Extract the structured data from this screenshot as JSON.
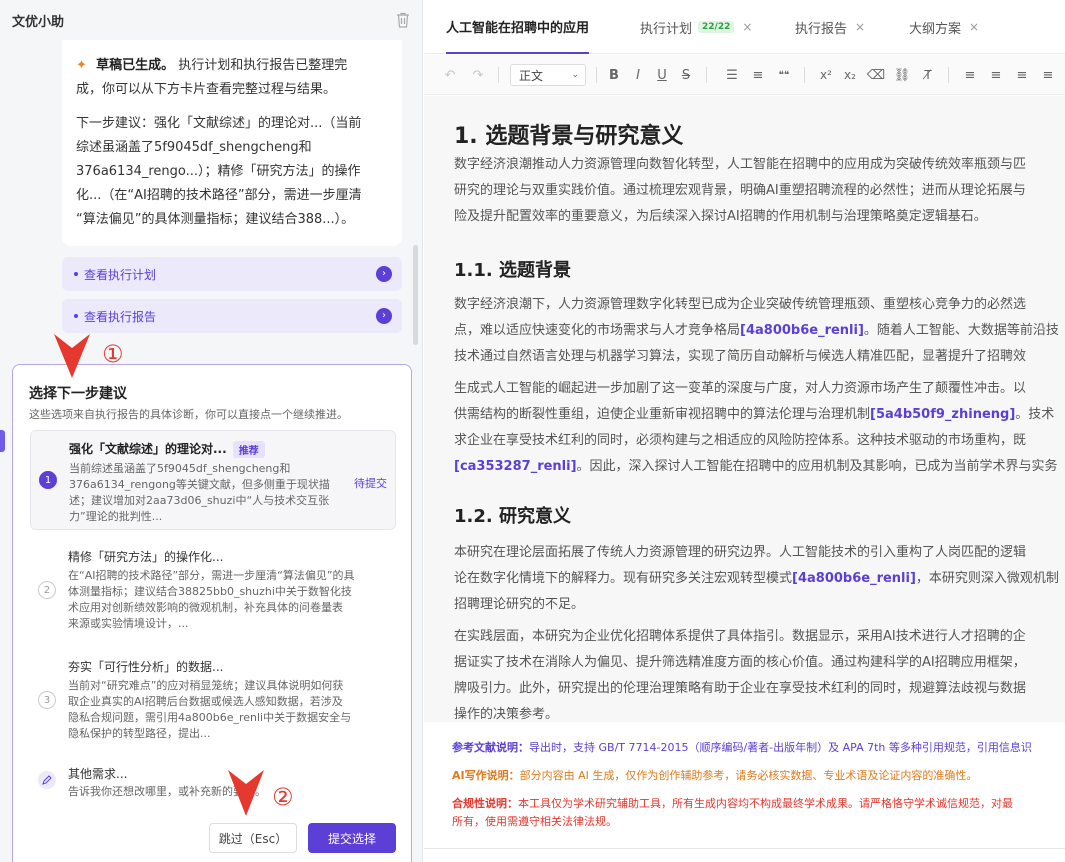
{
  "left": {
    "title": "文优小助",
    "message": {
      "headline": "草稿已生成。",
      "line1_rest": "执行计划和执行报告已整理完",
      "line2": "成，你可以从下方卡片查看完整过程与结果。",
      "p2_lines": [
        "下一步建议：强化「文献综述」的理论对...（当前",
        "综述虽涵盖了5f9045df_shengcheng和",
        "376a6134_rengo...）；精修「研究方法」的操作",
        "化...（在“AI招聘的技术路径”部分，需进一步厘清",
        "“算法偏见”的具体测量指标；建议结合388...）。"
      ]
    },
    "link_plan": "查看执行计划",
    "link_report": "查看执行报告",
    "suggestions": {
      "title": "选择下一步建议",
      "desc": "这些选项来自执行报告的具体诊断，你可以直接点一个继续推进。",
      "options": [
        {
          "num": "1",
          "title": "强化「文献综述」的理论对...",
          "badge": "推荐",
          "status": "待提交",
          "lines": [
            "当前综述虽涵盖了5f9045df_shengcheng和",
            "376a6134_rengong等关键文献，但多侧重于现状描",
            "述；建议增加对2aa73d06_shuzi中“人与技术交互张",
            "力”理论的批判性..."
          ]
        },
        {
          "num": "2",
          "title": "精修「研究方法」的操作化...",
          "lines": [
            "在“AI招聘的技术路径”部分，需进一步厘清“算法偏见”的具",
            "体测量指标；建议结合38825bb0_shuzhi中关于数智化技",
            "术应用对创新绩效影响的微观机制，补充具体的问卷量表",
            "来源或实验情境设计，..."
          ]
        },
        {
          "num": "3",
          "title": "夯实「可行性分析」的数据...",
          "lines": [
            "当前对“研究难点”的应对稍显笼统；建议具体说明如何获",
            "取企业真实的AI招聘后台数据或候选人感知数据，若涉及",
            "隐私合规问题，需引用4a800b6e_renli中关于数据安全与",
            "隐私保护的转型路径，提出..."
          ]
        },
        {
          "title": "其他需求...",
          "lines": [
            "告诉我你还想改哪里，或补充新的要求。"
          ]
        }
      ],
      "skip_label": "跳过（Esc）",
      "submit_label": "提交选择"
    },
    "annotations": [
      "①",
      "②"
    ]
  },
  "right": {
    "tabs": [
      {
        "label": "人工智能在招聘中的应用",
        "active": true
      },
      {
        "label": "执行计划",
        "count": "22/22",
        "close": "×"
      },
      {
        "label": "执行报告",
        "close": "×"
      },
      {
        "label": "大纲方案",
        "close": "×"
      }
    ],
    "toolbar": {
      "style_select": "正文",
      "icons": [
        "undo-icon",
        "redo-icon",
        "bold-icon",
        "italic-icon",
        "underline-icon",
        "strikethrough-icon",
        "bullet-list-icon",
        "numbered-list-icon",
        "quote-icon",
        "superscript-icon",
        "subscript-icon",
        "eraser-icon",
        "link-icon",
        "clear-format-icon",
        "align-left-icon",
        "align-center-icon",
        "align-right-icon",
        "justify-icon"
      ]
    },
    "doc": {
      "h1": "1. 选题背景与研究意义",
      "p1": [
        "数字经济浪潮推动人力资源管理向数智化转型，人工智能在招聘中的应用成为突破传统效率瓶颈与匹",
        "研究的理论与双重实践价值。通过梳理宏观背景，明确AI重塑招聘流程的必然性；进而从理论拓展与",
        "险及提升配置效率的重要意义，为后续深入探讨AI招聘的作用机制与治理策略奠定逻辑基石。"
      ],
      "h2a": "1.1. 选题背景",
      "p2": {
        "l1": "数字经济浪潮下，人力资源管理数字化转型已成为企业突破传统管理瓶颈、重塑核心竞争力的必然选",
        "l2_pre": "点，难以适应快速变化的市场需求与人才竞争格局",
        "l2_ref": "[4a800b6e_renli]",
        "l2_post": "。随着人工智能、大数据等前沿技",
        "l3": "技术通过自然语言处理与机器学习算法，实现了简历自动解析与候选人精准匹配，显著提升了招聘效"
      },
      "p3": {
        "l1": "生成式人工智能的崛起进一步加剧了这一变革的深度与广度，对人力资源市场产生了颠覆性冲击。以",
        "l2_pre": "供需结构的断裂性重组，迫使企业重新审视招聘中的算法伦理与治理机制",
        "l2_ref": "[5a4b50f9_zhineng]",
        "l2_post": "。技术",
        "l3": "求企业在享受技术红利的同时，必须构建与之相适应的风险防控体系。这种技术驱动的市场重构，既",
        "l4_ref": "[ca353287_renli]",
        "l4_post": "。因此，深入探讨人工智能在招聘中的应用机制及其影响，已成为当前学术界与实务"
      },
      "h2b": "1.2. 研究意义",
      "p4": {
        "l1": "本研究在理论层面拓展了传统人力资源管理的研究边界。人工智能技术的引入重构了人岗匹配的逻辑",
        "l2_pre": "论在数字化情境下的解释力。现有研究多关注宏观转型模式",
        "l2_ref": "[4a800b6e_renli]",
        "l2_post": "，本研究则深入微观机制",
        "l3": "招聘理论研究的不足。"
      },
      "p5": [
        "在实践层面，本研究为企业优化招聘体系提供了具体指引。数据显示，采用AI技术进行人才招聘的企",
        "据证实了技术在消除人为偏见、提升筛选精准度方面的核心价值。通过构建科学的AI招聘应用框架，",
        "牌吸引力。此外，研究提出的伦理治理策略有助于企业在享受技术红利的同时，规避算法歧视与数据",
        "操作的决策参考。"
      ]
    },
    "notes": {
      "ref_key": "参考文献说明：",
      "ref_text": "导出时，支持 GB/T 7714-2015（顺序编码/著者-出版年制）及 APA 7th 等多种引用规范，引用信息识",
      "ai_key": "AI写作说明：",
      "ai_text": "部分内容由 AI 生成，仅作为创作辅助参考，请务必核实数据、专业术语及论证内容的准确性。",
      "comp_key": "合规性说明：",
      "comp_text1": "本工具仅为学术研究辅助工具，所有生成内容均不构成最终学术成果。请严格恪守学术诚信规范，对最",
      "comp_text2": "所有，使用需遵守相关法律法规。"
    }
  },
  "colors": {
    "accent": "#5b3fd6",
    "annotation": "#e5392f",
    "note_orange": "#e07b1c"
  }
}
